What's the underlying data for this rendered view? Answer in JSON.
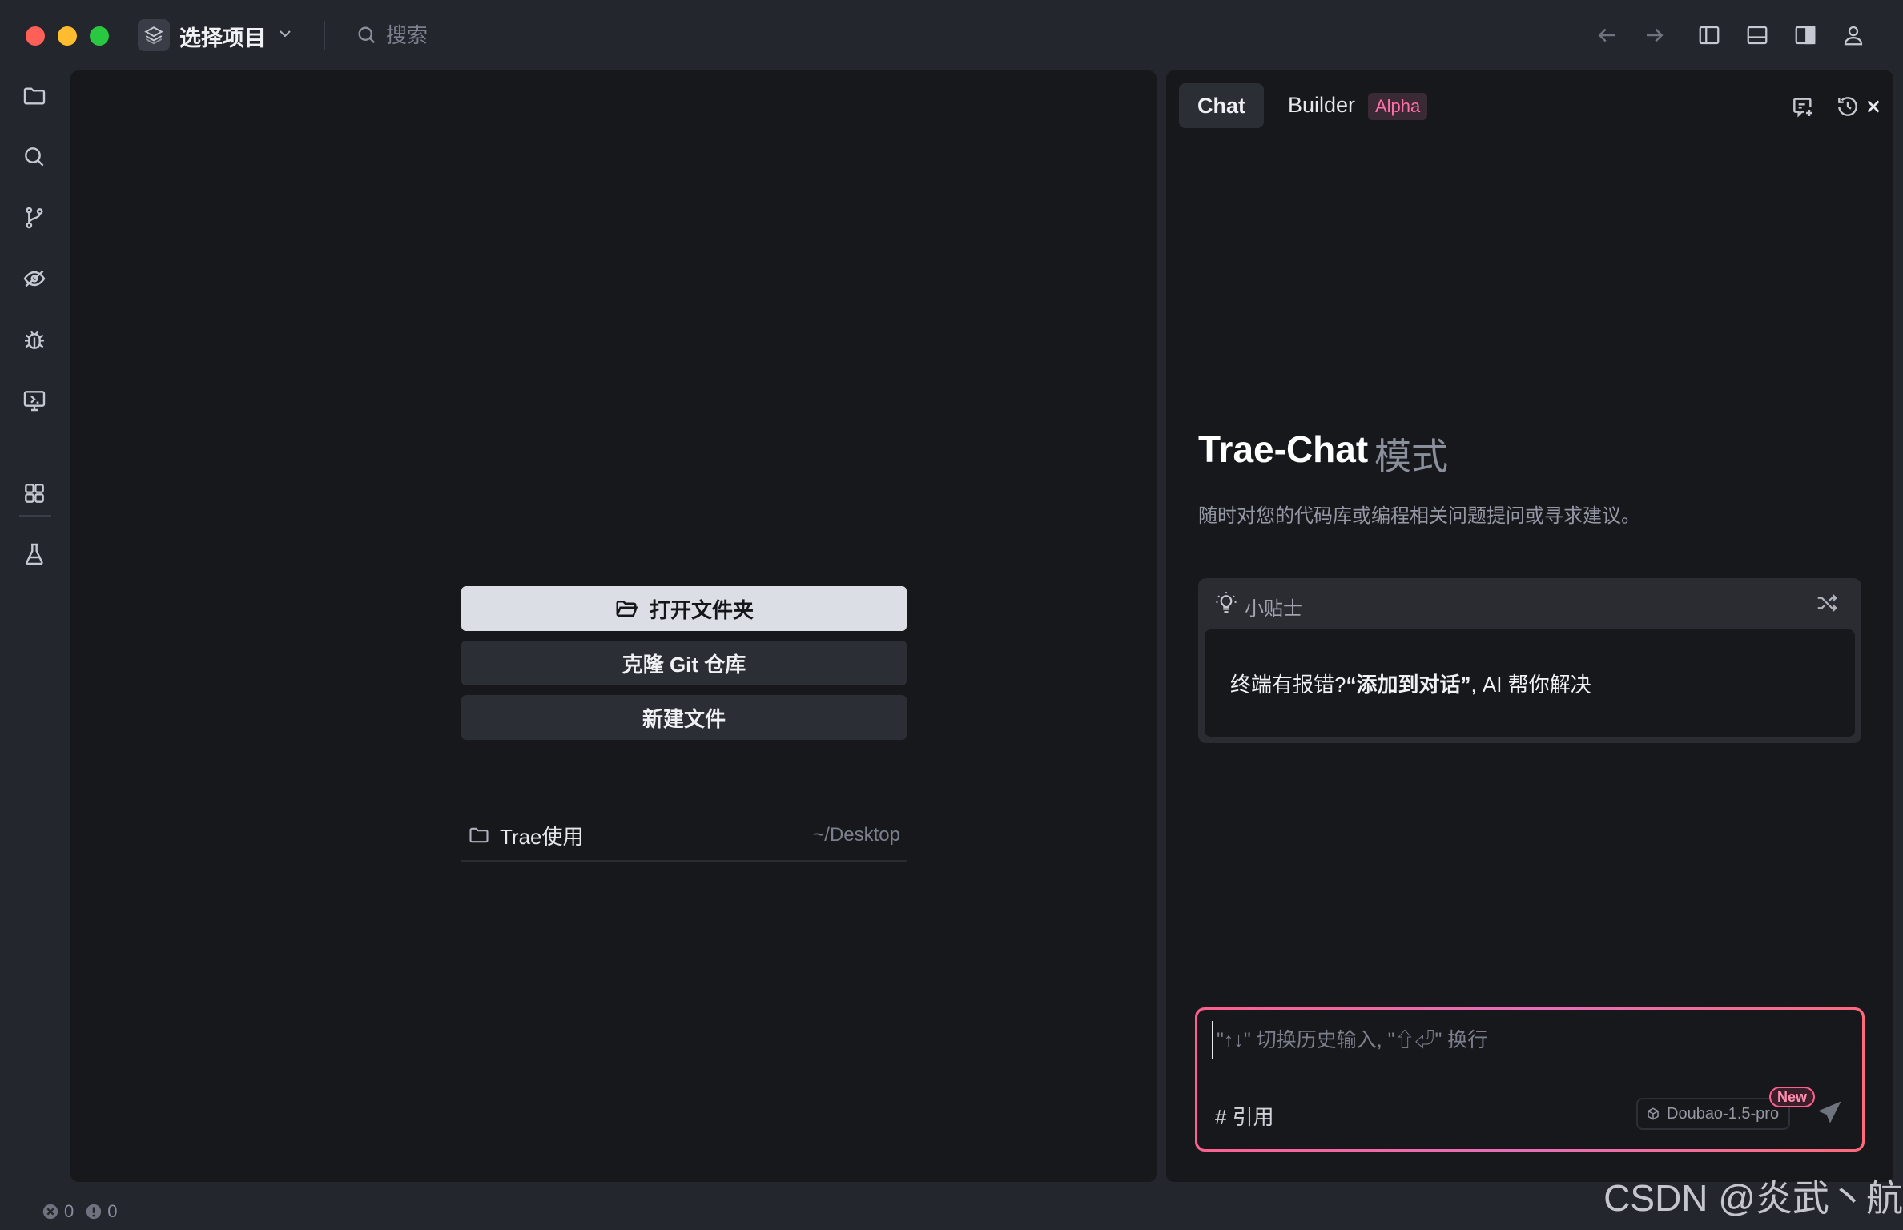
{
  "titlebar": {
    "project_label": "选择项目",
    "search_placeholder": "搜索"
  },
  "editor": {
    "open_folder_label": "打开文件夹",
    "clone_git_label": "克隆 Git 仓库",
    "new_file_label": "新建文件",
    "recent": [
      {
        "name": "Trae使用",
        "path": "~/Desktop"
      }
    ]
  },
  "chat": {
    "tabs": [
      {
        "label": "Chat",
        "active": true
      },
      {
        "label": "Builder",
        "badge": "Alpha"
      }
    ],
    "title": "Trae-Chat",
    "title_suffix": "模式",
    "description": "随时对您的代码库或编程相关问题提问或寻求建议。",
    "tips": {
      "header": "小贴士",
      "text_before": "终端有报错?",
      "text_emphasis": "“添加到对话”",
      "text_after": ", AI 帮你解决"
    },
    "input_placeholder": "\"↑↓\" 切换历史输入, \"⇧⏎\" 换行",
    "reference_label": "# 引用",
    "model": "Doubao-1.5-pro",
    "new_badge": "New"
  },
  "statusbar": {
    "errors": "0",
    "warnings": "0"
  },
  "watermark": "CSDN @炎武丶航",
  "colors": {
    "accent_pink": "#ff5f8f",
    "panel_bg": "#17181c",
    "chrome_bg": "#24262d"
  }
}
